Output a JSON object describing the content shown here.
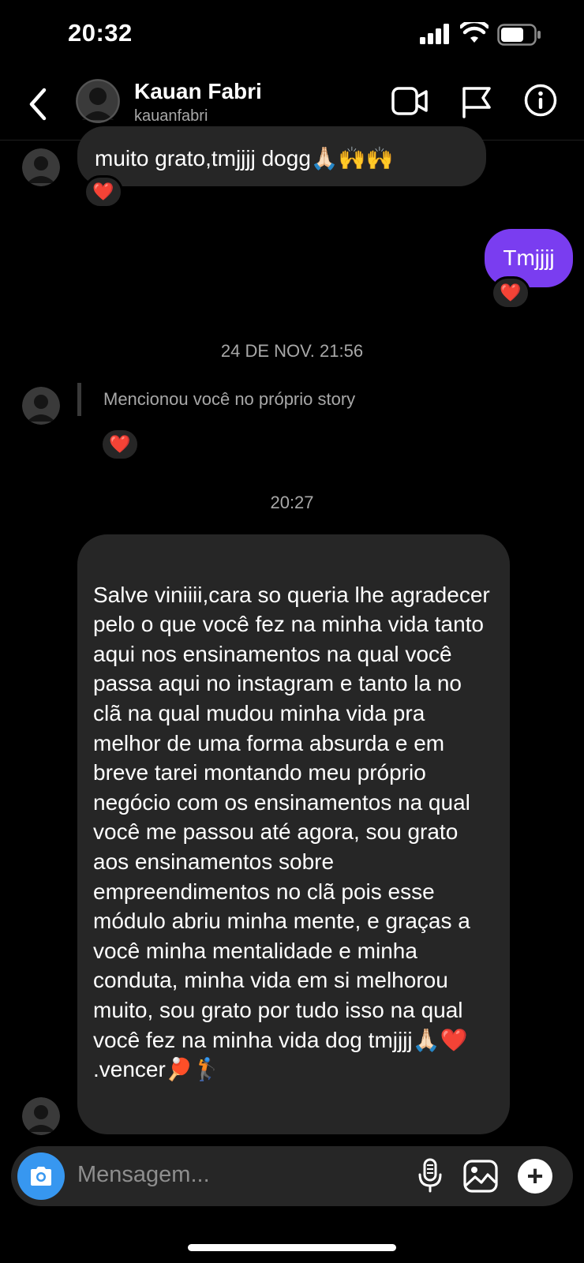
{
  "status_bar": {
    "time": "20:32"
  },
  "header": {
    "name": "Kauan Fabri",
    "username": "kauanfabri",
    "icons": [
      "back-icon",
      "video-call-icon",
      "flag-icon",
      "info-icon"
    ]
  },
  "messages": [
    {
      "type": "incoming",
      "text": "muito grato,tmjjjj dogg🙏🏻🙌🙌",
      "reaction": "❤️"
    },
    {
      "type": "outgoing",
      "text": "Tmjjjj",
      "reaction": "❤️"
    },
    {
      "type": "timestamp",
      "text": "24 DE NOV. 21:56"
    },
    {
      "type": "story_mention",
      "text": "Mencionou você no próprio story",
      "reaction": "❤️"
    },
    {
      "type": "timestamp",
      "text": "20:27"
    },
    {
      "type": "incoming",
      "text": "Salve viniiii,cara so queria lhe agradecer pelo o que você fez na minha vida tanto aqui nos ensinamentos na qual você passa aqui no instagram e tanto la no clã na qual mudou minha vida pra melhor de uma forma absurda e em breve tarei montando meu próprio negócio com os ensinamentos na qual você me passou até agora, sou grato aos ensinamentos sobre empreendimentos no clã pois esse módulo abriu minha mente, e graças a você minha mentalidade e minha conduta, minha vida em si melhorou muito, sou grato por tudo isso na qual você fez na minha vida dog tmjjjj🙏🏻❤️\n.vencer🏓🏌️"
    }
  ],
  "composer": {
    "placeholder": "Mensagem..."
  },
  "colors": {
    "background": "#000000",
    "incoming_bubble": "#262626",
    "outgoing_bubble": "#7a3df0",
    "camera_button": "#3797f0"
  }
}
